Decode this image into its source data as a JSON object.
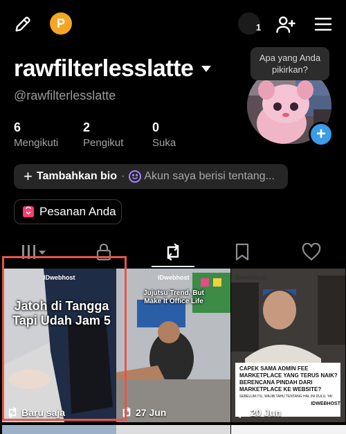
{
  "colors": {
    "background": "#000000",
    "accent_blue": "#3b9ce8",
    "coin": "#f6a524",
    "selection": "#e8554a",
    "muted": "#9a9a9a"
  },
  "topbar": {
    "edit_icon": "pencil-icon",
    "coin_letter": "P",
    "notification_count": "1",
    "add_user_icon": "person-add-icon",
    "menu_icon": "hamburger-icon"
  },
  "profile": {
    "username": "rawfilterlesslatte",
    "handle": "@rawfilterlesslatte",
    "stats": [
      {
        "value": "6",
        "label": "Mengikuti"
      },
      {
        "value": "2",
        "label": "Pengikut"
      },
      {
        "value": "0",
        "label": "Suka"
      }
    ],
    "tooltip": "Apa yang Anda pikirkan?",
    "bio_add": "Tambahkan bio",
    "bio_account": "Akun saya berisi tentang...",
    "orders": "Pesanan Anda"
  },
  "tabs": [
    {
      "icon": "grid-icon",
      "active": false
    },
    {
      "icon": "lock-icon",
      "active": false
    },
    {
      "icon": "repost-icon",
      "active": true
    },
    {
      "icon": "bookmark-icon",
      "active": false
    },
    {
      "icon": "heart-icon",
      "active": false
    }
  ],
  "videos": [
    {
      "brand": "IDwebhost",
      "caption": "Jatoh di Tangga Tapi Udah Jam 5",
      "date": "Baru saja"
    },
    {
      "brand": "IDwebhost",
      "caption": "Jujutsu Trend, But Make It Office Life",
      "date": "27 Jun"
    },
    {
      "brand": "IDwebhost",
      "caption_lines": [
        "CAPEK SAMA ADMIN FEE",
        "MARKETPLACE YANG TERUS NAIK?",
        "BERENCANA PINDAH DARI",
        "MARKETPLACE KE WEBSITE?"
      ],
      "small_note": "SEBELUM ITU, WAJIB TAHU TENTANG HAL INI DULU, YA!",
      "logo": "IDWEBHOST",
      "date": "20 Jun"
    }
  ]
}
